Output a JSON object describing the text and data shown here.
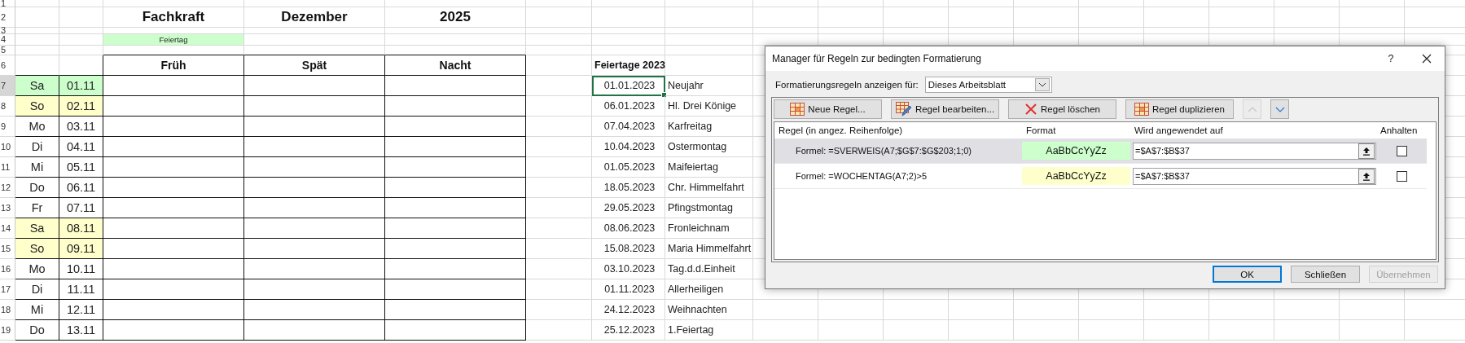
{
  "row_numbers": [
    "1",
    "2",
    "3",
    "4",
    "5",
    "6",
    "7",
    "8",
    "9",
    "10",
    "11",
    "12",
    "13",
    "14",
    "15",
    "16",
    "17",
    "18",
    "19"
  ],
  "heading": {
    "role": "Fachkraft",
    "month": "Dezember",
    "year": "2025"
  },
  "legend": {
    "label": "Feiertag"
  },
  "shift_columns": [
    "Früh",
    "Spät",
    "Nacht"
  ],
  "days": [
    {
      "weekday": "Sa",
      "date": "01.11",
      "kind": "holiday"
    },
    {
      "weekday": "So",
      "date": "02.11",
      "kind": "weekend"
    },
    {
      "weekday": "Mo",
      "date": "03.11",
      "kind": "workday"
    },
    {
      "weekday": "Di",
      "date": "04.11",
      "kind": "workday"
    },
    {
      "weekday": "Mi",
      "date": "05.11",
      "kind": "workday"
    },
    {
      "weekday": "Do",
      "date": "06.11",
      "kind": "workday"
    },
    {
      "weekday": "Fr",
      "date": "07.11",
      "kind": "workday"
    },
    {
      "weekday": "Sa",
      "date": "08.11",
      "kind": "weekend"
    },
    {
      "weekday": "So",
      "date": "09.11",
      "kind": "weekend"
    },
    {
      "weekday": "Mo",
      "date": "10.11",
      "kind": "workday"
    },
    {
      "weekday": "Di",
      "date": "11.11",
      "kind": "workday"
    },
    {
      "weekday": "Mi",
      "date": "12.11",
      "kind": "workday"
    },
    {
      "weekday": "Do",
      "date": "13.11",
      "kind": "workday"
    }
  ],
  "holidays": {
    "title": "Feiertage 2023",
    "rows": [
      {
        "date": "01.01.2023",
        "name": "Neujahr",
        "selected": true
      },
      {
        "date": "06.01.2023",
        "name": "Hl. Drei Könige",
        "selected": false
      },
      {
        "date": "07.04.2023",
        "name": "Karfreitag",
        "selected": false
      },
      {
        "date": "10.04.2023",
        "name": "Ostermontag",
        "selected": false
      },
      {
        "date": "01.05.2023",
        "name": "Maifeiertag",
        "selected": false
      },
      {
        "date": "18.05.2023",
        "name": "Chr. Himmelfahrt",
        "selected": false
      },
      {
        "date": "29.05.2023",
        "name": "Pfingstmontag",
        "selected": false
      },
      {
        "date": "08.06.2023",
        "name": "Fronleichnam",
        "selected": false
      },
      {
        "date": "15.08.2023",
        "name": "Maria Himmelfahrt",
        "selected": false
      },
      {
        "date": "03.10.2023",
        "name": "Tag.d.d.Einheit",
        "selected": false
      },
      {
        "date": "01.11.2023",
        "name": "Allerheiligen",
        "selected": false
      },
      {
        "date": "24.12.2023",
        "name": "Weihnachten",
        "selected": false
      },
      {
        "date": "25.12.2023",
        "name": "1.Feiertag",
        "selected": false
      }
    ]
  },
  "dialog": {
    "title": "Manager für Regeln zur bedingten Formatierung",
    "help": "?",
    "scope_label": "Formatierungsregeln anzeigen für:",
    "scope_value": "Dieses Arbeitsblatt",
    "toolbar": [
      {
        "label": "Neue Regel...",
        "kind": "new"
      },
      {
        "label": "Regel bearbeiten...",
        "kind": "edit"
      },
      {
        "label": "Regel löschen",
        "kind": "delete"
      },
      {
        "label": "Regel duplizieren",
        "kind": "duplicate"
      }
    ],
    "move_buttons": [
      {
        "kind": "up",
        "disabled": true
      },
      {
        "kind": "down",
        "disabled": false
      }
    ],
    "columns": [
      "Regel (in angez. Reihenfolge)",
      "Format",
      "Wird angewendet auf",
      "Anhalten"
    ],
    "rules": [
      {
        "formula": "Formel: =SVERWEIS(A7;$G$7:$G$203;1;0)",
        "preview": "AaBbCcYyZz",
        "color": "#ccffcc",
        "applies_to": "=$A$7:$B$37",
        "stop": false,
        "selected": true
      },
      {
        "formula": "Formel: =WOCHENTAG(A7;2)>5",
        "preview": "AaBbCcYyZz",
        "color": "#ffffcc",
        "applies_to": "=$A$7:$B$37",
        "stop": false,
        "selected": false
      }
    ],
    "footer_buttons": [
      {
        "label": "OK",
        "default": true,
        "disabled": false
      },
      {
        "label": "Schließen",
        "default": false,
        "disabled": false
      },
      {
        "label": "Übernehmen",
        "default": false,
        "disabled": true
      }
    ]
  }
}
